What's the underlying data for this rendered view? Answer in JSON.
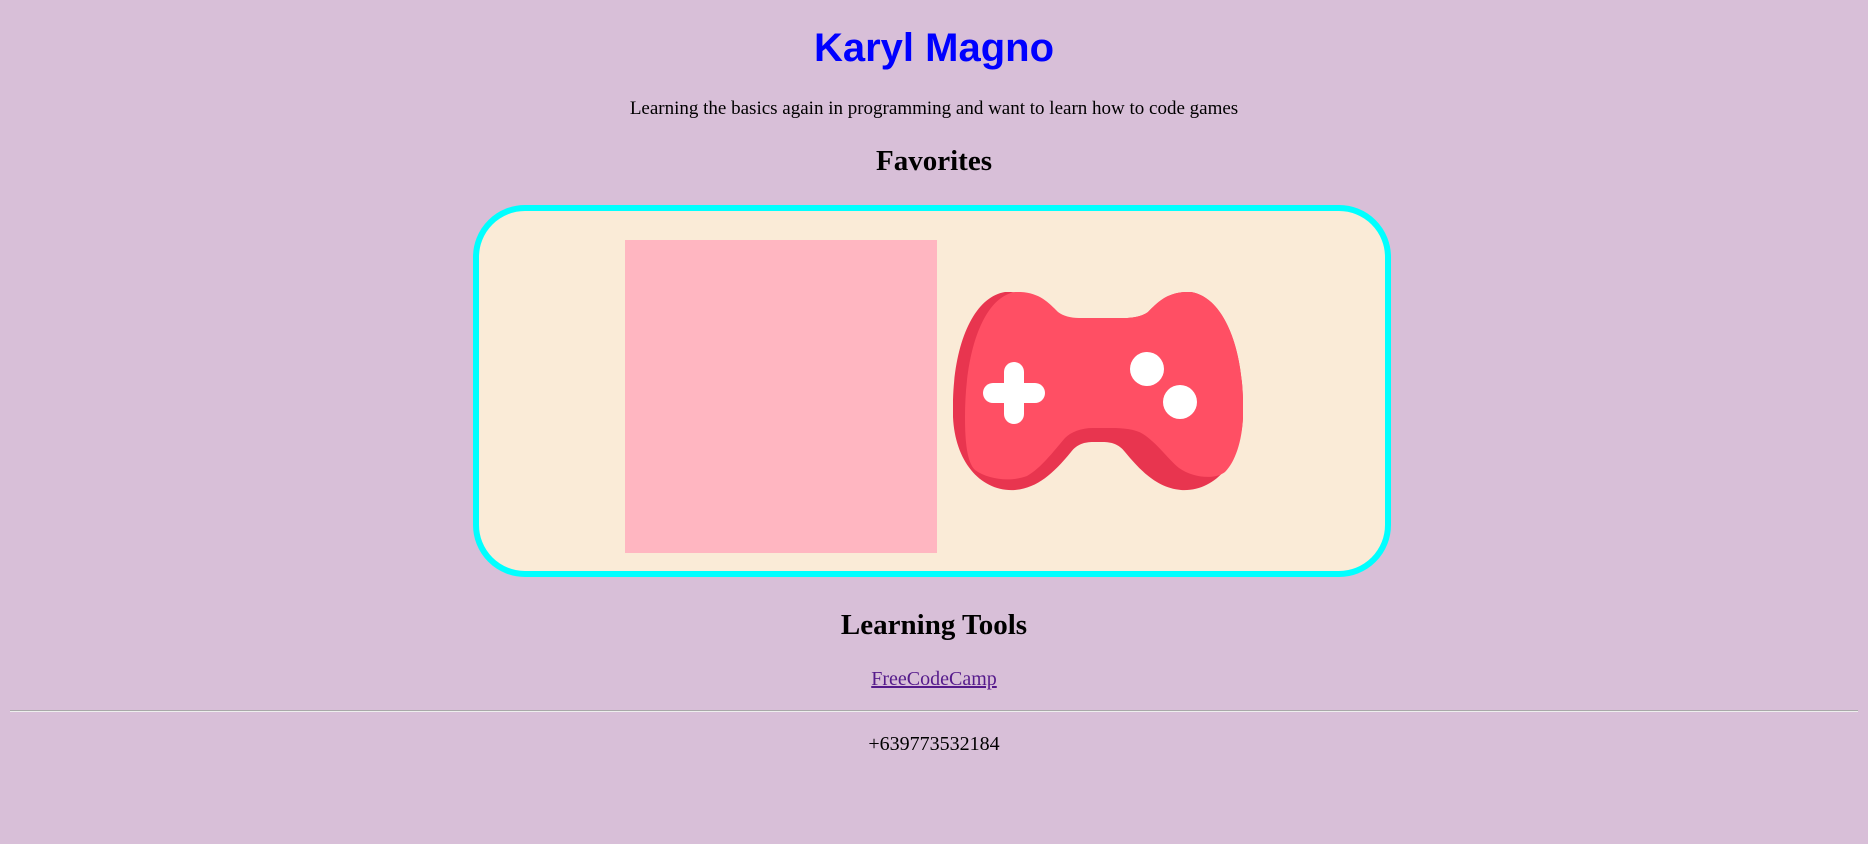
{
  "header": {
    "name": "Karyl Magno",
    "bio": "Learning the basics again in programming and want to learn how to code games"
  },
  "favorites": {
    "title": "Favorites",
    "image_icon": "gamepad-icon"
  },
  "learning_tools": {
    "title": "Learning Tools",
    "links": [
      "FreeCodeCamp"
    ]
  },
  "footer": {
    "phone": "+639773532184"
  },
  "colors": {
    "background": "#d8bfd8",
    "name": "#0000ff",
    "box_border": "#00ffff",
    "box_background": "#faebd7",
    "pink_square": "#ffb6c1",
    "gamepad": "#ff4f64"
  }
}
